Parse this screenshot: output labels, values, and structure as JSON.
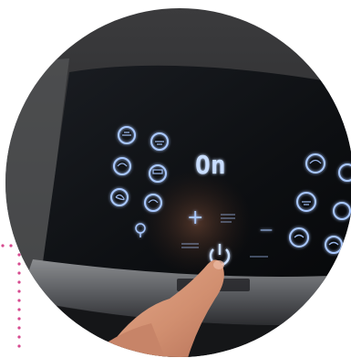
{
  "panel": {
    "display": "On",
    "icon_names": [
      "preset-icon",
      "preset-icon",
      "preset-icon",
      "preset-icon",
      "preset-icon",
      "preset-icon",
      "preset-icon",
      "preset-icon",
      "preset-icon",
      "preset-icon",
      "preset-icon",
      "preset-icon",
      "preset-icon",
      "preset-icon",
      "preset-icon"
    ],
    "plus_symbol": "+",
    "minus_symbol": "—",
    "power_icon": "power-icon",
    "light_icon": "light-icon"
  },
  "colors": {
    "panel_glass": "#101216",
    "backlight": "#a9c8ff",
    "display_glow": "#c9deff",
    "skin": "#d99a7c",
    "bezel": "#6a6c70",
    "dots": "#d64a8f"
  }
}
